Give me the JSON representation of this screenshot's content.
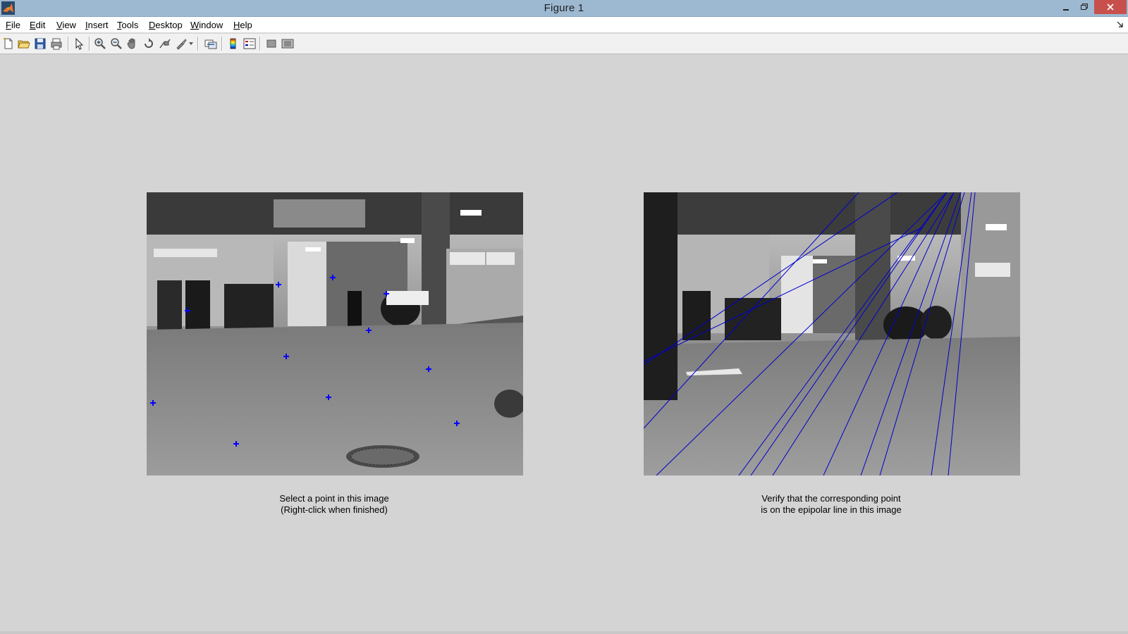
{
  "window": {
    "title": "Figure 1"
  },
  "menubar": {
    "items": [
      {
        "mnemonic": "F",
        "rest": "ile"
      },
      {
        "mnemonic": "E",
        "rest": "dit"
      },
      {
        "mnemonic": "V",
        "rest": "iew"
      },
      {
        "mnemonic": "I",
        "rest": "nsert"
      },
      {
        "mnemonic": "T",
        "rest": "ools"
      },
      {
        "mnemonic": "D",
        "rest": "esktop"
      },
      {
        "mnemonic": "W",
        "rest": "indow"
      },
      {
        "mnemonic": "H",
        "rest": "elp"
      }
    ]
  },
  "toolbar": {
    "tools": [
      "new-figure-icon",
      "open-file-icon",
      "save-icon",
      "print-icon",
      "edit-plot-arrow-icon",
      "zoom-in-icon",
      "zoom-out-icon",
      "pan-hand-icon",
      "rotate-3d-icon",
      "data-cursor-icon",
      "brush-icon",
      "link-plot-icon",
      "colorbar-icon",
      "legend-icon",
      "hide-plot-tools-icon",
      "show-plot-tools-icon"
    ]
  },
  "left_panel": {
    "caption_line1": "Select a point in this image",
    "caption_line2": "(Right-click when finished)",
    "marker_color": "#0000ff"
  },
  "right_panel": {
    "caption_line1": "Verify that the corresponding point",
    "caption_line2": "is on the epipolar line in this image",
    "line_color": "#0000cc"
  }
}
